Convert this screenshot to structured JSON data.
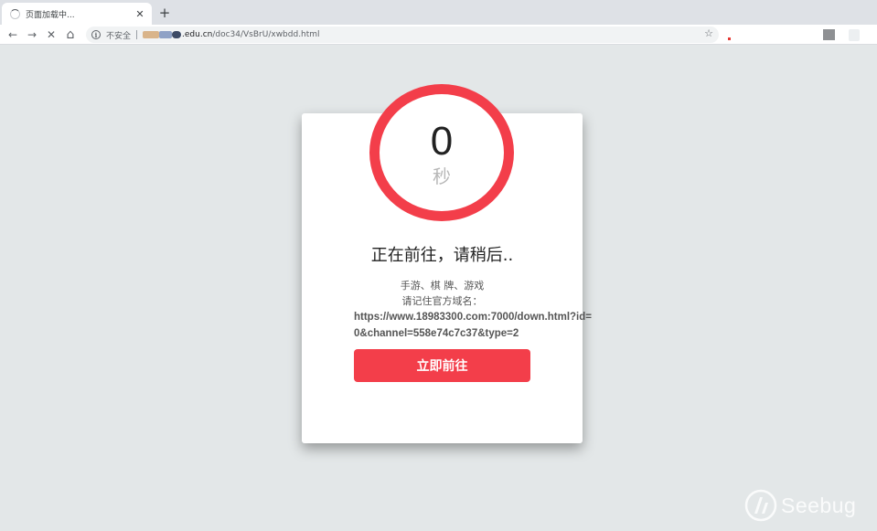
{
  "browser": {
    "tab_title": "页面加载中...",
    "tab_close": "✕",
    "new_tab": "+",
    "nav": {
      "back_icon": "←",
      "forward_icon": "→",
      "stop_icon": "✕",
      "home_icon": "⌂"
    },
    "security_label": "不安全",
    "url_domain": ".edu.cn",
    "url_path": "/doc34/VsBrU/xwbdd.html",
    "star_icon": "☆"
  },
  "countdown": {
    "value": "0",
    "unit": "秒",
    "ring_color": "#f33e4a"
  },
  "card": {
    "heading": "正在前往，请稍后..",
    "line1": "手游、棋 牌、游戏",
    "line2": "请记住官方域名：",
    "link": "https://www.18983300.com:7000/down.html?id=0&channel=558e74c7c37&type=2",
    "button_label": "立即前往",
    "accent_color": "#f33e4a"
  },
  "watermark": {
    "text": "Seebug"
  }
}
